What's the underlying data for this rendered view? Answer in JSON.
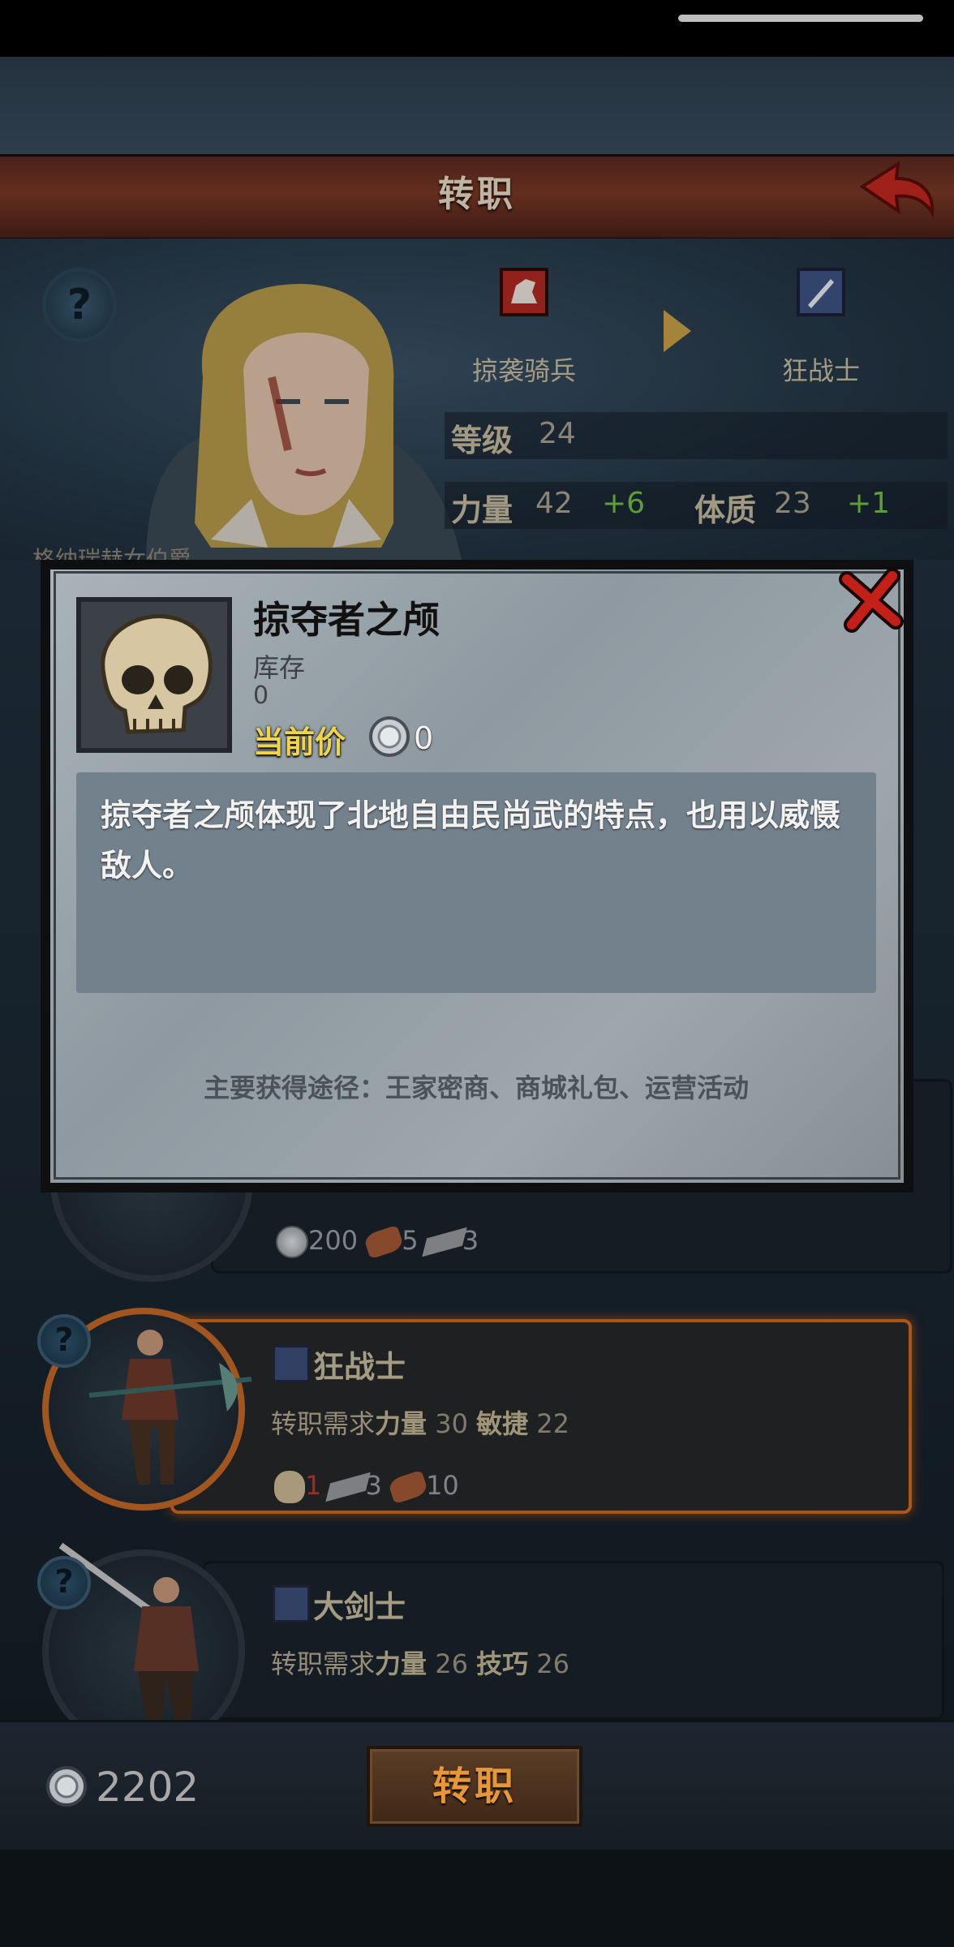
{
  "header": {
    "title": "转职"
  },
  "hero": {
    "from_class": "掠袭骑兵",
    "to_class": "狂战士",
    "level_label": "等级",
    "level_value": "24",
    "str_label": "力量",
    "str_value": "42",
    "str_bonus": "+6",
    "con_label": "体质",
    "con_value": "23",
    "con_bonus": "+1",
    "name_fragment": "格纳瑞赫女伯爵"
  },
  "classes": [
    {
      "name": "",
      "costs": [
        {
          "icon": "silver-coin-icon",
          "value": "200"
        },
        {
          "icon": "leather-icon",
          "value": "5"
        },
        {
          "icon": "iron-ingot-icon",
          "value": "3"
        }
      ]
    },
    {
      "name": "狂战士",
      "req_prefix": "转职需求",
      "req_stat1": "力量",
      "req_val1": "30",
      "req_stat2": "敏捷",
      "req_val2": "22",
      "costs": [
        {
          "icon": "skull-icon",
          "value": "1",
          "insufficient": true
        },
        {
          "icon": "iron-ingot-icon",
          "value": "3"
        },
        {
          "icon": "leather-icon",
          "value": "10"
        }
      ],
      "selected": true
    },
    {
      "name": "大剑士",
      "req_prefix": "转职需求",
      "req_stat1": "力量",
      "req_val1": "26",
      "req_stat2": "技巧",
      "req_val2": "26"
    }
  ],
  "item_modal": {
    "name": "掠夺者之颅",
    "stock_label": "库存",
    "stock_value": "0",
    "price_label": "当前价",
    "price_value": "0",
    "description": "掠夺者之颅体现了北地自由民尚武的特点，也用以威慑敌人。",
    "source": "主要获得途径：王家密商、商城礼包、运营活动"
  },
  "footer": {
    "money": "2202",
    "confirm_label": "转职"
  },
  "colors": {
    "accent_gold": "#f0d54a",
    "bonus_green": "#6fc441",
    "selected_orange": "#d06a1e",
    "insufficient_red": "#c8352a"
  }
}
